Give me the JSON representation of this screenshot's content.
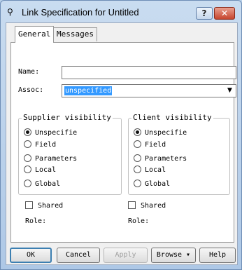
{
  "window": {
    "title": "Link Specification for Untitled",
    "help_glyph": "?",
    "close_glyph": "✕"
  },
  "tabs": [
    {
      "label": "General"
    },
    {
      "label": "Messages"
    }
  ],
  "form": {
    "name_label": "Name:",
    "name_value": "",
    "assoc_label": "Assoc:",
    "assoc_value": "unspecified"
  },
  "supplier": {
    "title": "Supplier visibility",
    "options": [
      "Unspecifie",
      "Field",
      "Parameters",
      "Local",
      "Global"
    ],
    "selected": "Unspecifie"
  },
  "client": {
    "title": "Client visibility",
    "options": [
      "Unspecifie",
      "Field",
      "Parameters",
      "Local",
      "Global"
    ],
    "selected": "Unspecifie"
  },
  "shared": {
    "label": "Shared"
  },
  "role": {
    "label": "Role:"
  },
  "buttons": {
    "ok": "OK",
    "cancel": "Cancel",
    "apply": "Apply",
    "browse": "Browse ▾",
    "help": "Help"
  }
}
